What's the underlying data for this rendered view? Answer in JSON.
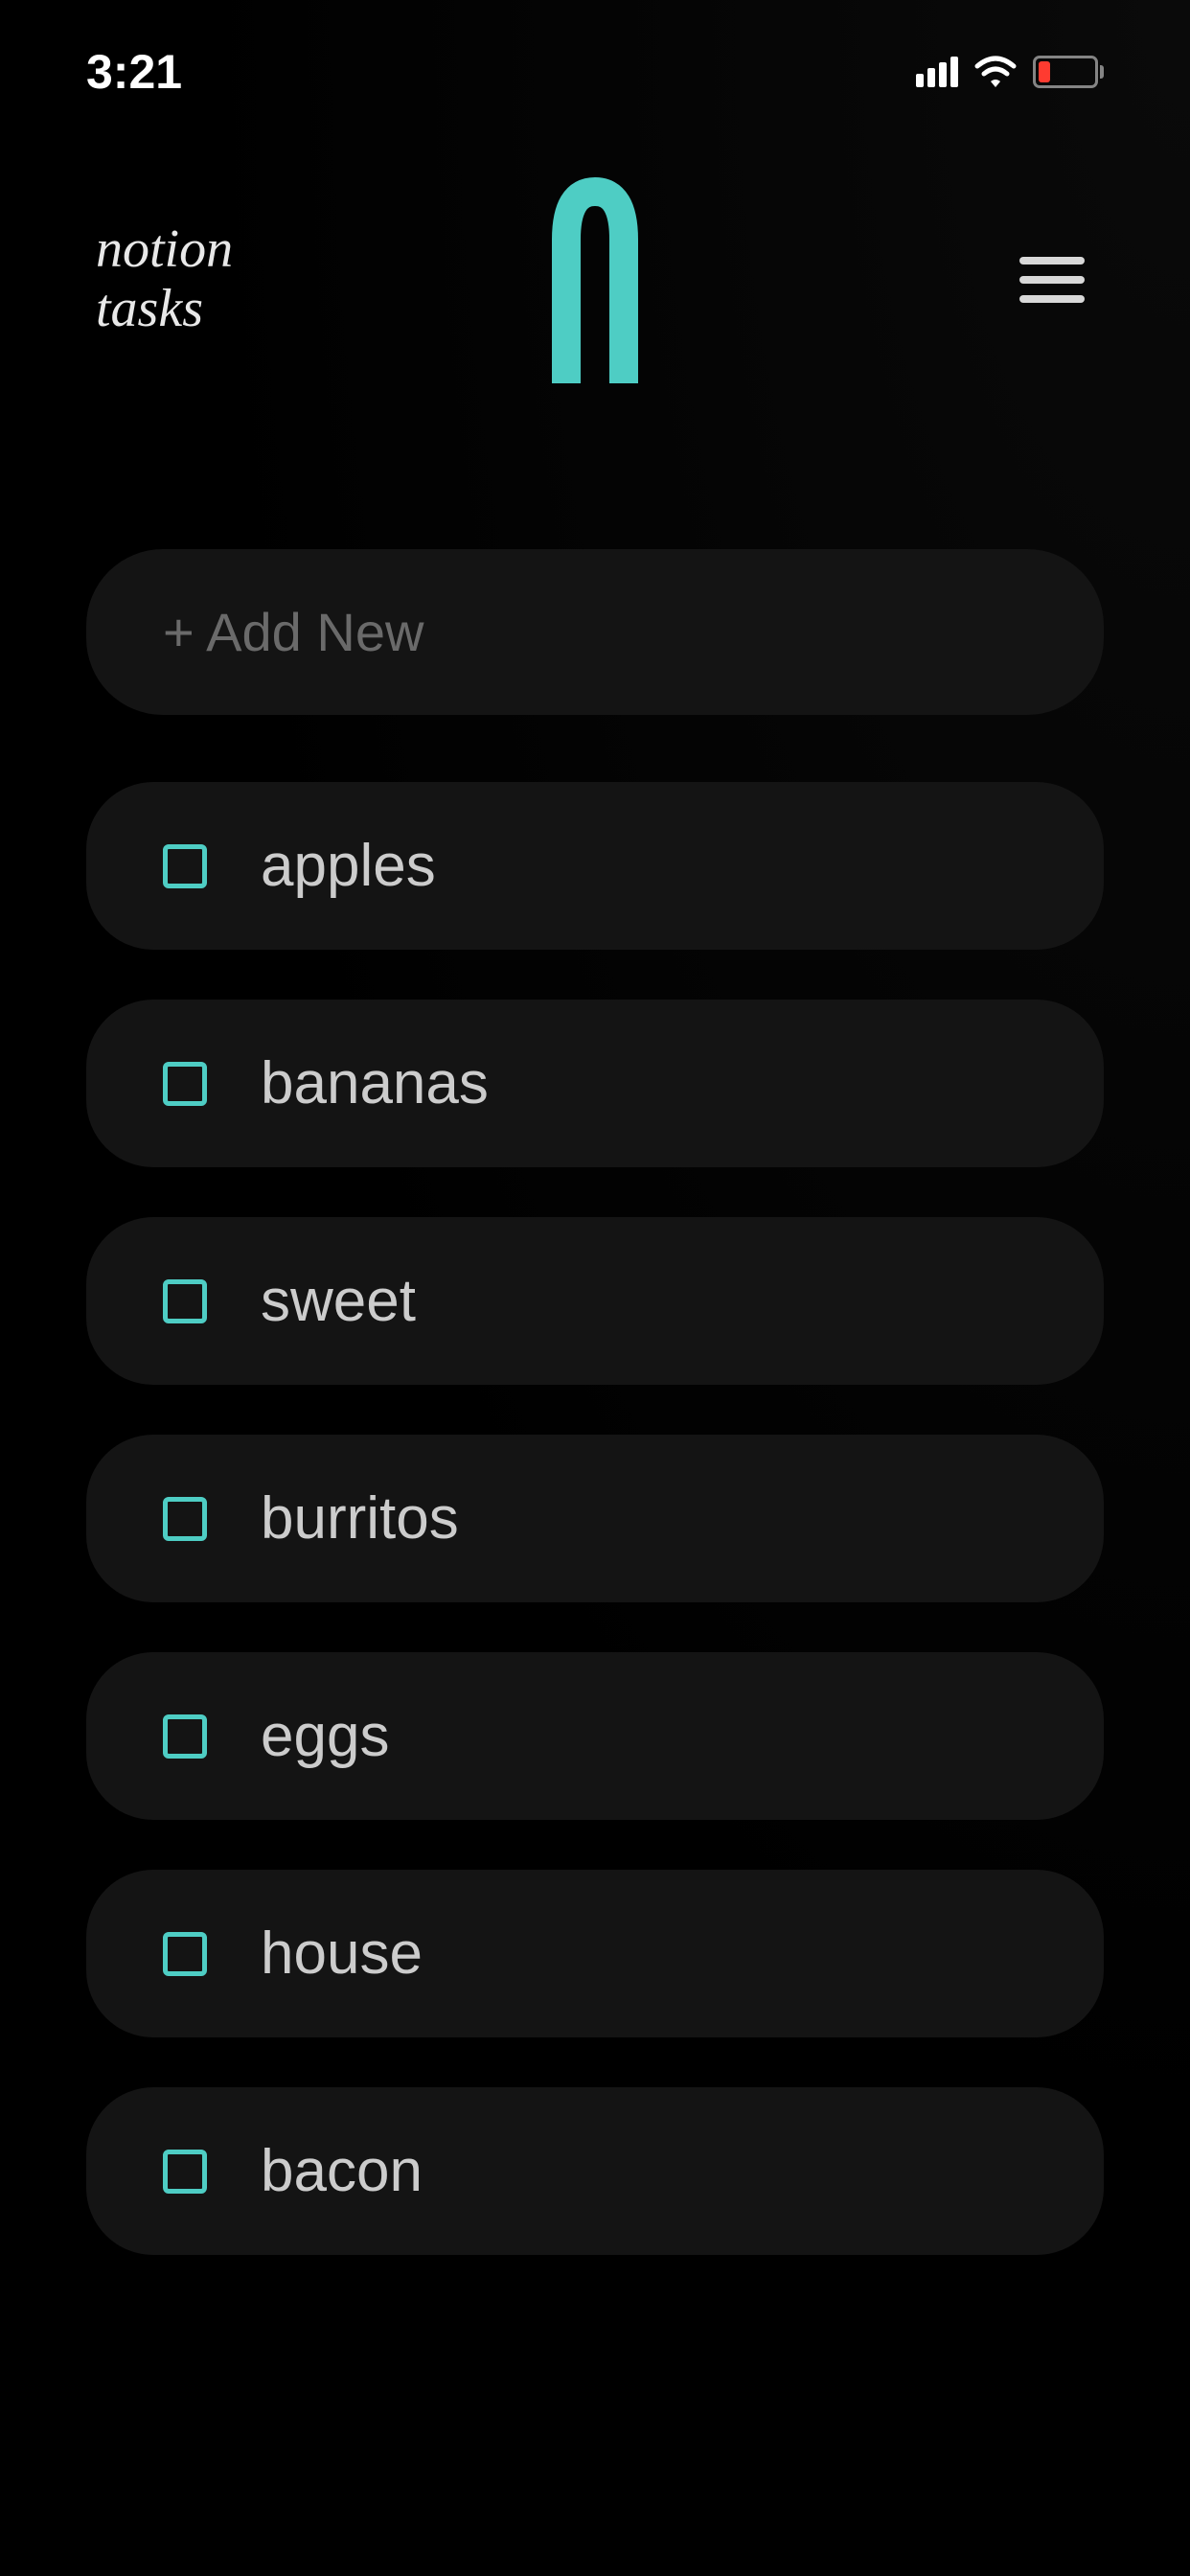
{
  "status_bar": {
    "time": "3:21"
  },
  "header": {
    "title_line1": "notion",
    "title_line2": "tasks"
  },
  "add_new": {
    "label": "+ Add New"
  },
  "tasks": [
    {
      "label": "apples",
      "checked": false
    },
    {
      "label": "bananas",
      "checked": false
    },
    {
      "label": "sweet",
      "checked": false
    },
    {
      "label": "burritos",
      "checked": false
    },
    {
      "label": "eggs",
      "checked": false
    },
    {
      "label": "house",
      "checked": false
    },
    {
      "label": "bacon",
      "checked": false
    }
  ],
  "colors": {
    "accent": "#4ecdc4",
    "background": "#000000",
    "card": "#141414",
    "text": "#cccccc",
    "muted": "#6a6a6a"
  }
}
